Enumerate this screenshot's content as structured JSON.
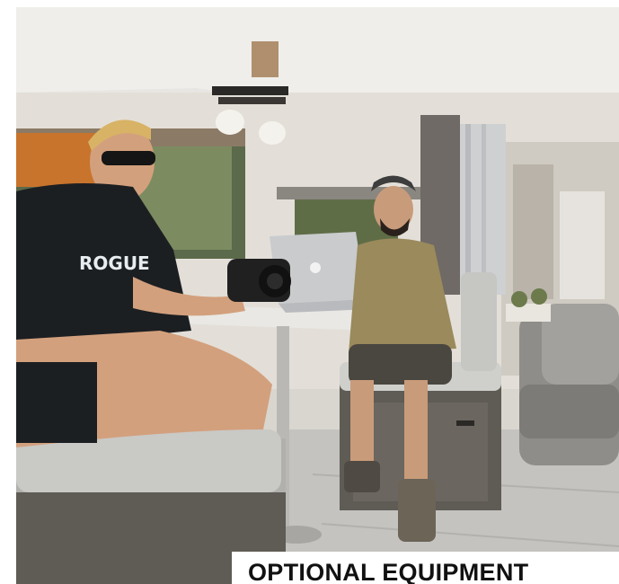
{
  "photo": {
    "description_icon": "rv-interior-photo",
    "shirt_logo_text": "ROGUE"
  },
  "caption": {
    "text": "OPTIONAL EQUIPMENT"
  },
  "colors": {
    "caption_text": "#111111",
    "caption_bg": "#ffffff",
    "shirt": "#1c1f22",
    "olive_shirt": "#9a8a5c",
    "upholstery": "#c9c9c6"
  }
}
